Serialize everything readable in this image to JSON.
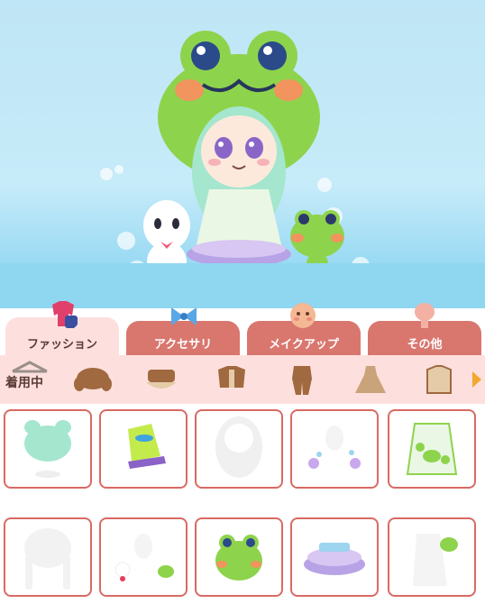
{
  "tabs": [
    {
      "label": "ファッション",
      "active": true
    },
    {
      "label": "アクセサリ",
      "active": false
    },
    {
      "label": "メイクアップ",
      "active": false
    },
    {
      "label": "その他",
      "active": false
    }
  ],
  "category_bar": {
    "equipped_label": "着用中",
    "categories": [
      "hair-icon",
      "hat-icon",
      "top-icon",
      "coverall-icon",
      "dress-icon",
      "outer-icon"
    ],
    "next_icon": "arrow-right-icon"
  },
  "items": [
    "green-twin-hair",
    "green-sneakers",
    "white-long-hair",
    "bubble-accessories",
    "frog-dress",
    "white-braided-hair",
    "plush-companions",
    "frog-hood-hat",
    "layered-skirt",
    "frog-backpack"
  ],
  "colors": {
    "frog_green": "#8ed34c",
    "tab_active": "#fde0dd",
    "tab_inactive": "#d9776f",
    "cell_border": "#d96a63",
    "sky": "#c6ebf9"
  }
}
